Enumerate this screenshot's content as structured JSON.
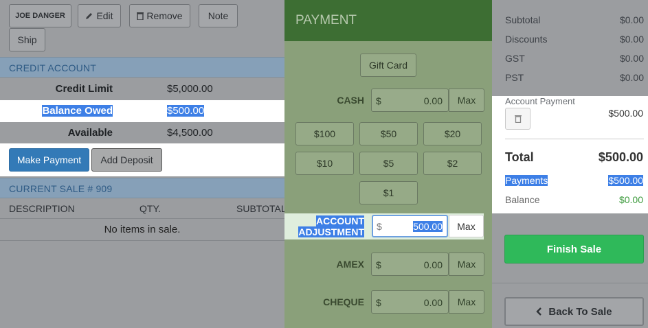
{
  "customer": {
    "name": "JOE DANGER",
    "edit": "Edit",
    "remove": "Remove",
    "note": "Note",
    "ship": "Ship"
  },
  "credit": {
    "heading": "CREDIT ACCOUNT",
    "rows": [
      {
        "label": "Credit Limit",
        "value": "$5,000.00"
      },
      {
        "label": "Balance Owed",
        "value": "$500.00"
      },
      {
        "label": "Available",
        "value": "$4,500.00"
      }
    ],
    "make_payment": "Make Payment",
    "add_deposit": "Add Deposit"
  },
  "sale": {
    "heading": "CURRENT SALE # 909",
    "col_description": "DESCRIPTION",
    "col_qty": "QTY.",
    "col_subtotal": "SUBTOTAL",
    "empty": "No items in sale."
  },
  "payment": {
    "heading": "PAYMENT",
    "gift_card": "Gift Card",
    "cash": {
      "label": "CASH",
      "currency": "$",
      "value": "0.00",
      "max": "Max"
    },
    "quick": [
      "$100",
      "$50",
      "$20",
      "$10",
      "$5",
      "$2",
      "$1"
    ],
    "adjust": {
      "label_line1": "ACCOUNT",
      "label_line2": "ADJUSTMENT",
      "currency": "$",
      "value": "500.00",
      "max": "Max"
    },
    "amex": {
      "label": "AMEX",
      "currency": "$",
      "value": "0.00",
      "max": "Max"
    },
    "cheque": {
      "label": "CHEQUE",
      "currency": "$",
      "value": "0.00",
      "max": "Max"
    }
  },
  "summary": {
    "subtotal_label": "Subtotal",
    "subtotal": "$0.00",
    "discounts_label": "Discounts",
    "discounts": "$0.00",
    "gst_label": "GST",
    "gst": "$0.00",
    "pst_label": "PST",
    "pst": "$0.00",
    "acct_payment_label": "Account Payment",
    "acct_payment": "$500.00",
    "total_label": "Total",
    "total": "$500.00",
    "payments_label": "Payments",
    "payments": "$500.00",
    "balance_label": "Balance",
    "balance": "$0.00",
    "finish": "Finish Sale",
    "back": "Back To Sale"
  },
  "colors": {
    "accent_blue": "#337ab7",
    "finish_green": "#2fb95a",
    "balance_green": "#3c9a3c"
  }
}
